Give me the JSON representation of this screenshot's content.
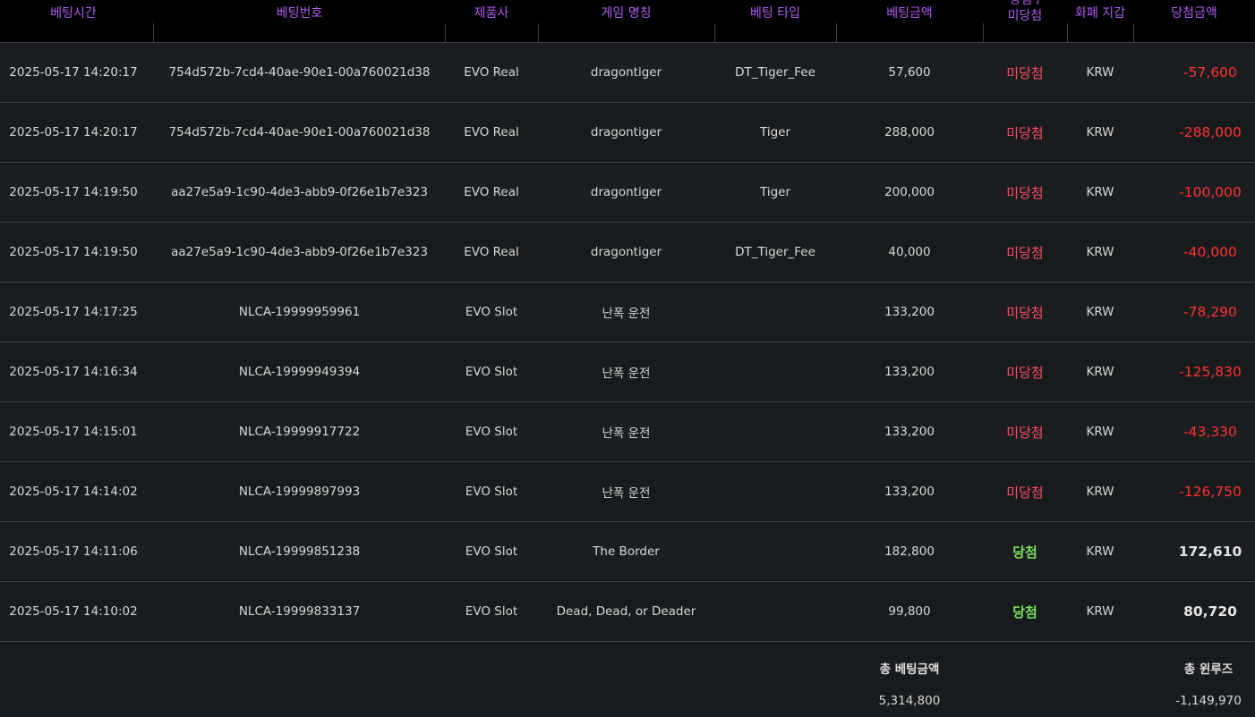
{
  "header": {
    "col_time": "베팅시간",
    "col_id": "베팅번호",
    "col_provider": "제품사",
    "col_game": "게임 명칭",
    "col_bet_type": "베팅 타입",
    "col_bet_amount": "베팅금액",
    "col_result_line1": "당첨 /",
    "col_result_line2": "미당첨",
    "col_currency": "화폐 지갑",
    "col_win_amount": "당첨금액"
  },
  "rows": [
    {
      "time": "2025-05-17 14:20:17",
      "id": "754d572b-7cd4-40ae-90e1-00a760021d38",
      "provider": "EVO Real",
      "game": "dragontiger",
      "bet_type": "DT_Tiger_Fee",
      "bet_amount": "57,600",
      "result": "미당첨",
      "win": false,
      "currency": "KRW",
      "win_amount": "-57,600"
    },
    {
      "time": "2025-05-17 14:20:17",
      "id": "754d572b-7cd4-40ae-90e1-00a760021d38",
      "provider": "EVO Real",
      "game": "dragontiger",
      "bet_type": "Tiger",
      "bet_amount": "288,000",
      "result": "미당첨",
      "win": false,
      "currency": "KRW",
      "win_amount": "-288,000"
    },
    {
      "time": "2025-05-17 14:19:50",
      "id": "aa27e5a9-1c90-4de3-abb9-0f26e1b7e323",
      "provider": "EVO Real",
      "game": "dragontiger",
      "bet_type": "Tiger",
      "bet_amount": "200,000",
      "result": "미당첨",
      "win": false,
      "currency": "KRW",
      "win_amount": "-100,000"
    },
    {
      "time": "2025-05-17 14:19:50",
      "id": "aa27e5a9-1c90-4de3-abb9-0f26e1b7e323",
      "provider": "EVO Real",
      "game": "dragontiger",
      "bet_type": "DT_Tiger_Fee",
      "bet_amount": "40,000",
      "result": "미당첨",
      "win": false,
      "currency": "KRW",
      "win_amount": "-40,000"
    },
    {
      "time": "2025-05-17 14:17:25",
      "id": "NLCA-19999959961",
      "provider": "EVO Slot",
      "game": "난폭 운전",
      "bet_type": "",
      "bet_amount": "133,200",
      "result": "미당첨",
      "win": false,
      "currency": "KRW",
      "win_amount": "-78,290"
    },
    {
      "time": "2025-05-17 14:16:34",
      "id": "NLCA-19999949394",
      "provider": "EVO Slot",
      "game": "난폭 운전",
      "bet_type": "",
      "bet_amount": "133,200",
      "result": "미당첨",
      "win": false,
      "currency": "KRW",
      "win_amount": "-125,830"
    },
    {
      "time": "2025-05-17 14:15:01",
      "id": "NLCA-19999917722",
      "provider": "EVO Slot",
      "game": "난폭 운전",
      "bet_type": "",
      "bet_amount": "133,200",
      "result": "미당첨",
      "win": false,
      "currency": "KRW",
      "win_amount": "-43,330"
    },
    {
      "time": "2025-05-17 14:14:02",
      "id": "NLCA-19999897993",
      "provider": "EVO Slot",
      "game": "난폭 운전",
      "bet_type": "",
      "bet_amount": "133,200",
      "result": "미당첨",
      "win": false,
      "currency": "KRW",
      "win_amount": "-126,750"
    },
    {
      "time": "2025-05-17 14:11:06",
      "id": "NLCA-19999851238",
      "provider": "EVO Slot",
      "game": "The Border",
      "bet_type": "",
      "bet_amount": "182,800",
      "result": "당첨",
      "win": true,
      "currency": "KRW",
      "win_amount": "172,610"
    },
    {
      "time": "2025-05-17 14:10:02",
      "id": "NLCA-19999833137",
      "provider": "EVO Slot",
      "game": "Dead, Dead, or Deader",
      "bet_type": "",
      "bet_amount": "99,800",
      "result": "당첨",
      "win": true,
      "currency": "KRW",
      "win_amount": "80,720"
    }
  ],
  "footer": {
    "total_bet_label": "총 베팅금액",
    "total_bet_value": "5,314,800",
    "total_winloss_label": "총 윈루즈",
    "total_winloss_value": "-1,149,970"
  },
  "colors": {
    "header_text": "#b05cf0",
    "lose_status": "#ff4a62",
    "win_status": "#7de05a",
    "negative_amount": "#ff3030"
  }
}
